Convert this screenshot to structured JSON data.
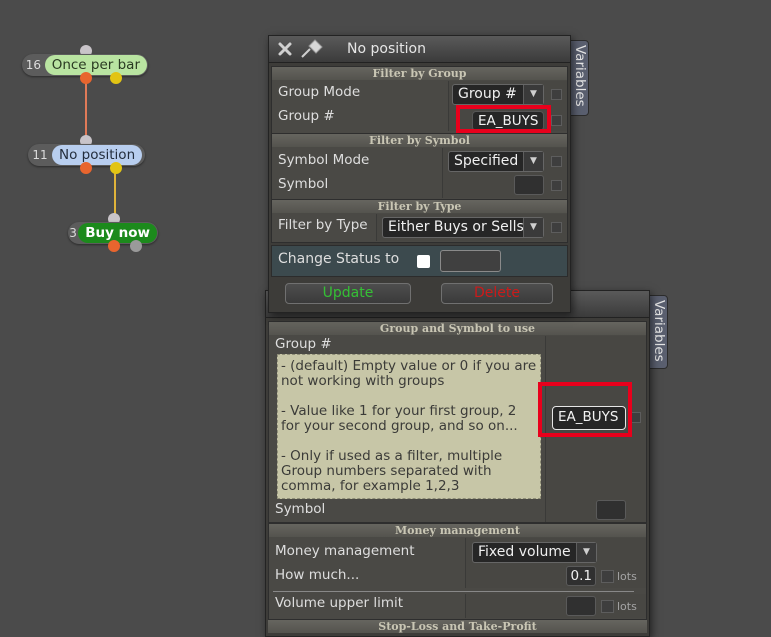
{
  "nodes": [
    {
      "num": "16",
      "label": "Once per bar",
      "bg": "#b9e4a1",
      "fg": "#2a3a22"
    },
    {
      "num": "11",
      "label": "No position",
      "bg": "#b8ceef",
      "fg": "#232d3c"
    },
    {
      "num": "3",
      "label": "Buy now",
      "bg": "#1c8a1c",
      "fg": "#ffffff"
    }
  ],
  "popup": {
    "title": "No position",
    "variables_tab": "Variables",
    "sections": {
      "group": "Filter by Group",
      "symbol": "Filter by Symbol",
      "type": "Filter by Type"
    },
    "group_mode_label": "Group Mode",
    "group_mode_value": "Group #",
    "group_num_label": "Group #",
    "group_num_value": "EA_BUYS",
    "symbol_mode_label": "Symbol Mode",
    "symbol_mode_value": "Specified",
    "symbol_label": "Symbol",
    "filter_type_label": "Filter by Type",
    "filter_type_value": "Either Buys or Sells",
    "change_status_label": "Change Status to",
    "update_label": "Update",
    "delete_label": "Delete"
  },
  "behind": {
    "variables_tab": "Variables",
    "section_group": "Group and Symbol to use",
    "group_label": "Group #",
    "help_lines": [
      "- (default) Empty value or 0 if you are not working with groups",
      "- Value like 1 for your first group, 2 for your second group, and so on...",
      "- Only if used as a filter, multiple Group numbers separated with comma, for example 1,2,3"
    ],
    "group_value": "EA_BUYS",
    "symbol_label": "Symbol",
    "section_money": "Money management",
    "mm_label": "Money management",
    "mm_value": "Fixed volume",
    "how_much_label": "How much...",
    "how_much_value": "0.1",
    "lots_unit": "lots",
    "vol_limit_label": "Volume upper limit",
    "lots_unit2": "lots",
    "section_sl": "Stop-Loss and Take-Profit"
  },
  "colors": {
    "update": "#35c035",
    "delete": "#cc1a1a",
    "highlight": "#e8001c"
  }
}
